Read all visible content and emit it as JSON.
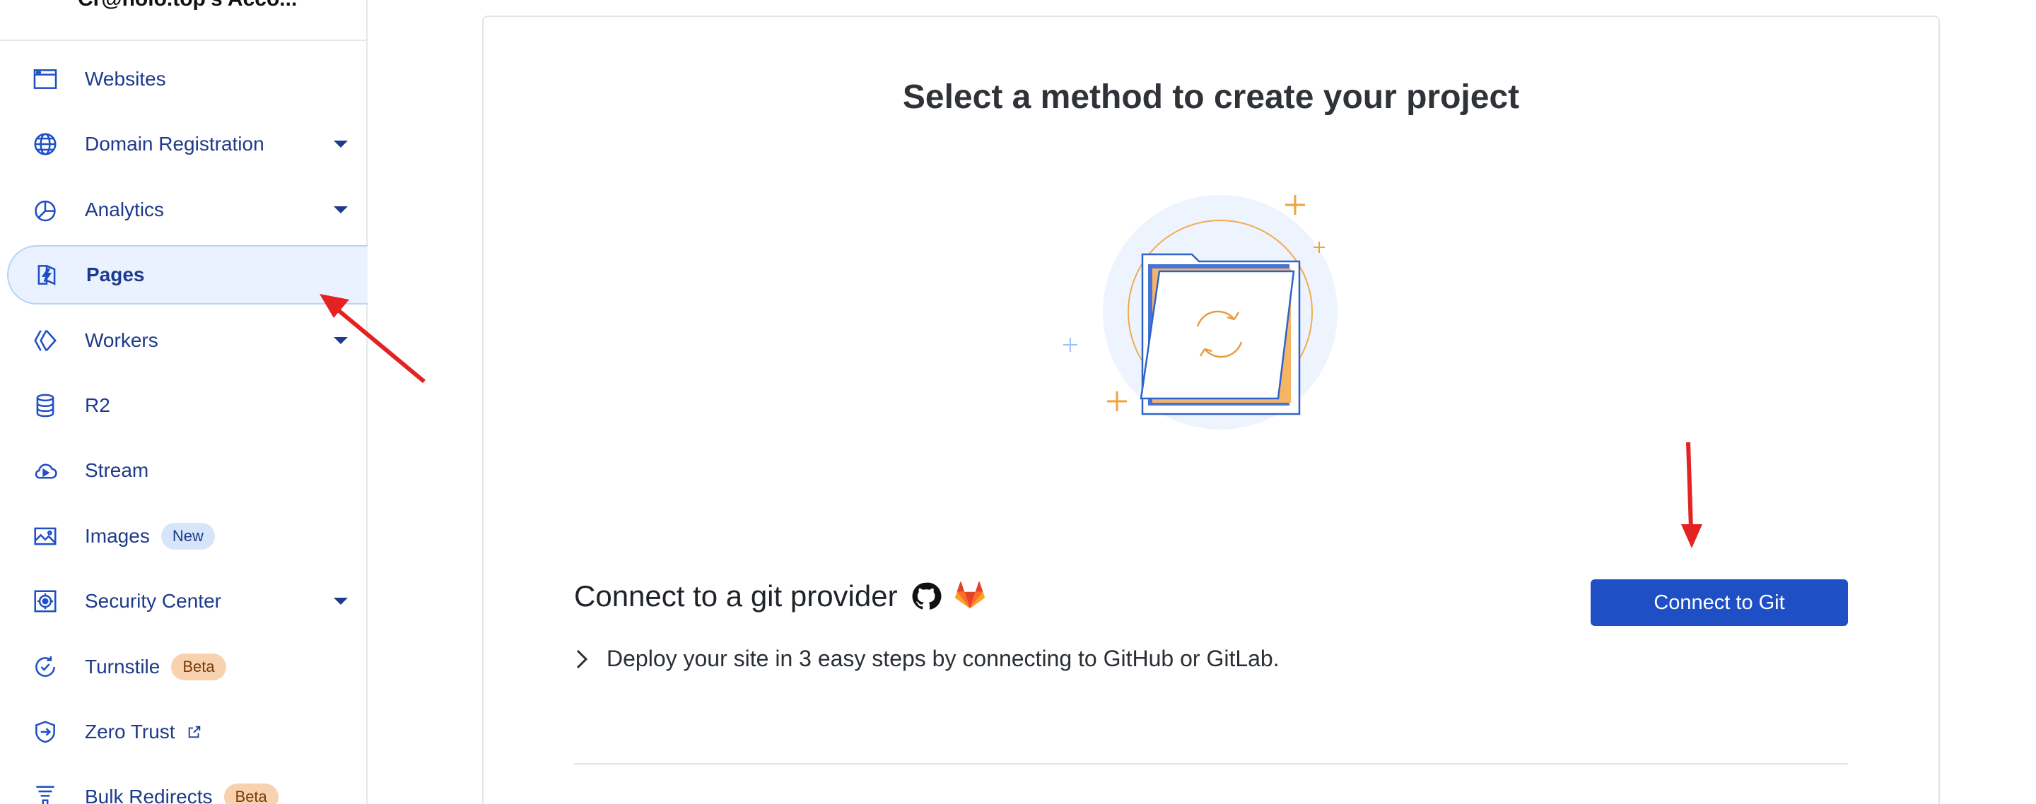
{
  "account": {
    "name": "Cr@holo.top's Acco..."
  },
  "sidebar": {
    "items": [
      {
        "label": "Websites",
        "icon": "browser-window-icon",
        "has_caret": false
      },
      {
        "label": "Domain Registration",
        "icon": "globe-icon",
        "has_caret": true
      },
      {
        "label": "Analytics",
        "icon": "pie-chart-icon",
        "has_caret": true
      },
      {
        "label": "Pages",
        "icon": "lightning-page-icon",
        "has_caret": false,
        "active": true
      },
      {
        "label": "Workers",
        "icon": "workers-diamond-icon",
        "has_caret": true
      },
      {
        "label": "R2",
        "icon": "database-icon",
        "has_caret": false
      },
      {
        "label": "Stream",
        "icon": "cloud-play-icon",
        "has_caret": false
      },
      {
        "label": "Images",
        "icon": "image-icon",
        "has_caret": false,
        "badge": "New"
      },
      {
        "label": "Security Center",
        "icon": "security-center-icon",
        "has_caret": true
      },
      {
        "label": "Turnstile",
        "icon": "turnstile-icon",
        "has_caret": false,
        "badge": "Beta"
      },
      {
        "label": "Zero Trust",
        "icon": "shield-arrow-icon",
        "has_caret": false,
        "external": true
      },
      {
        "label": "Bulk Redirects",
        "icon": "funnel-icon",
        "has_caret": false,
        "badge": "Beta"
      }
    ]
  },
  "main": {
    "title": "Select a method to create your project",
    "git": {
      "heading": "Connect to a git provider",
      "button_label": "Connect to Git",
      "description": "Deploy your site in 3 easy steps by connecting to GitHub or GitLab."
    }
  },
  "colors": {
    "nav_text": "#1e3a8a",
    "active_bg": "#eaf2ff",
    "primary_button": "#1e4fc5",
    "annotation": "#e32222"
  }
}
